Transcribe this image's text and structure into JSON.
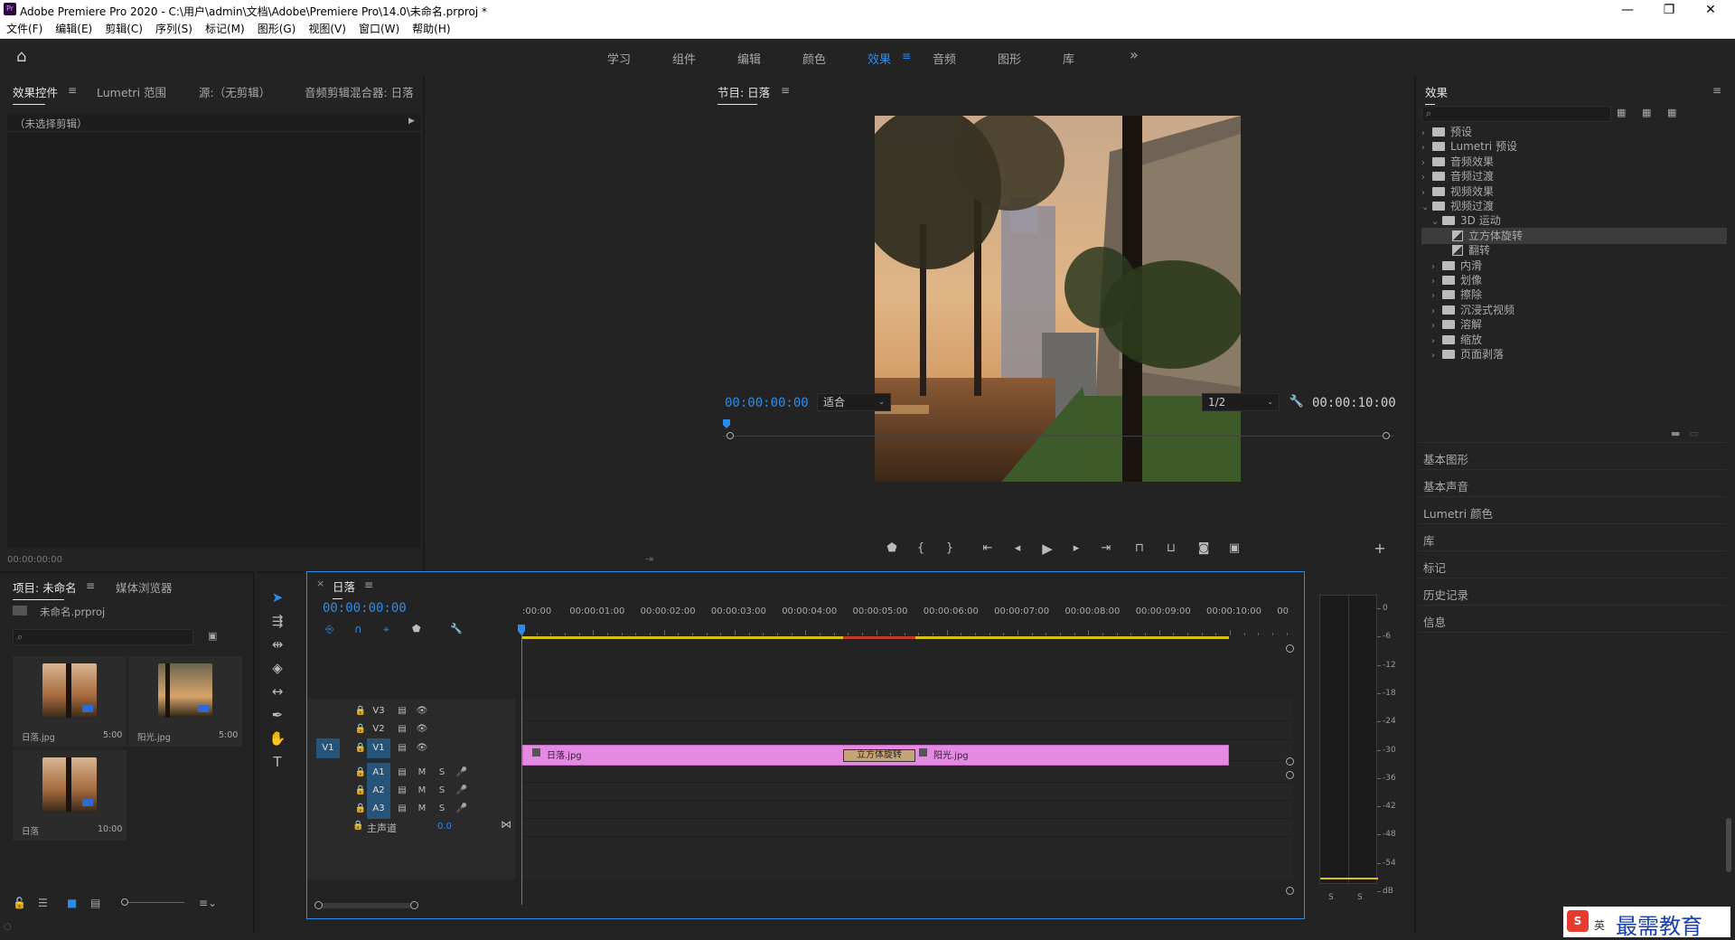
{
  "app": {
    "title": "Adobe Premiere Pro 2020 - C:\\用户\\admin\\文档\\Adobe\\Premiere Pro\\14.0\\未命名.prproj *",
    "logo": "Pr",
    "min": "—",
    "max": "❐",
    "close": "✕"
  },
  "menu": [
    "文件(F)",
    "编辑(E)",
    "剪辑(C)",
    "序列(S)",
    "标记(M)",
    "图形(G)",
    "视图(V)",
    "窗口(W)",
    "帮助(H)"
  ],
  "workspaces": {
    "tabs": [
      "学习",
      "组件",
      "编辑",
      "颜色",
      "效果",
      "音频",
      "图形",
      "库"
    ],
    "active": "效果",
    "more": "»"
  },
  "source_panel": {
    "tabs": [
      "效果控件",
      "Lumetri 范围",
      "源:（无剪辑）",
      "音频剪辑混合器: 日落"
    ],
    "no_clip": "（未选择剪辑）",
    "timecode": "00:00:00:00"
  },
  "program": {
    "title": "节目: 日落",
    "timecode_in": "00:00:00:00",
    "fit": "适合",
    "res": "1/2",
    "duration": "00:00:10:00"
  },
  "effects": {
    "title": "效果",
    "search_placeholder": "",
    "tree": [
      {
        "label": "预设",
        "level": 0,
        "open": false
      },
      {
        "label": "Lumetri 预设",
        "level": 0,
        "open": false
      },
      {
        "label": "音频效果",
        "level": 0,
        "open": false
      },
      {
        "label": "音频过渡",
        "level": 0,
        "open": false
      },
      {
        "label": "视频效果",
        "level": 0,
        "open": false
      },
      {
        "label": "视频过渡",
        "level": 0,
        "open": true
      },
      {
        "label": "3D 运动",
        "level": 1,
        "open": true
      },
      {
        "label": "立方体旋转",
        "level": 2,
        "fx": true,
        "selected": true
      },
      {
        "label": "翻转",
        "level": 2,
        "fx": true
      },
      {
        "label": "内滑",
        "level": 1,
        "open": false
      },
      {
        "label": "划像",
        "level": 1,
        "open": false
      },
      {
        "label": "擦除",
        "level": 1,
        "open": false
      },
      {
        "label": "沉浸式视频",
        "level": 1,
        "open": false
      },
      {
        "label": "溶解",
        "level": 1,
        "open": false
      },
      {
        "label": "缩放",
        "level": 1,
        "open": false
      },
      {
        "label": "页面剥落",
        "level": 1,
        "open": false
      }
    ],
    "side_panels": [
      "基本图形",
      "基本声音",
      "Lumetri 颜色",
      "库",
      "标记",
      "历史记录",
      "信息"
    ]
  },
  "project": {
    "tabs": [
      "项目: 未命名",
      "媒体浏览器"
    ],
    "file": "未命名.prproj",
    "items": [
      {
        "name": "日落.jpg",
        "dur": "5:00"
      },
      {
        "name": "阳光.jpg",
        "dur": "5:00"
      },
      {
        "name": "日落",
        "dur": "10:00"
      }
    ]
  },
  "timeline": {
    "title": "日落",
    "close": "×",
    "timecode": "00:00:00:00",
    "ruler": [
      ":00:00",
      "00:00:01:00",
      "00:00:02:00",
      "00:00:03:00",
      "00:00:04:00",
      "00:00:05:00",
      "00:00:06:00",
      "00:00:07:00",
      "00:00:08:00",
      "00:00:09:00",
      "00:00:10:00",
      "00"
    ],
    "video_tracks": [
      "V3",
      "V2",
      "V1"
    ],
    "audio_tracks": [
      "A1",
      "A2",
      "A3"
    ],
    "src_patch": "V1",
    "master": "主声道",
    "master_val": "0.0",
    "clip1": "日落.jpg",
    "clip2": "阳光.jpg",
    "transition": "立方体旋转",
    "m": "M",
    "s": "S"
  },
  "meter": {
    "scale": [
      "0",
      "-6",
      "-12",
      "-18",
      "-24",
      "-30",
      "-36",
      "-42",
      "-48",
      "-54",
      "dB"
    ],
    "solo": [
      "S",
      "S"
    ]
  },
  "watermark": {
    "text": "最需教育",
    "ime": "英"
  },
  "colors": {
    "accent": "#2d8ceb",
    "clip": "#e48ae2",
    "selection": "#3b3b3b"
  }
}
